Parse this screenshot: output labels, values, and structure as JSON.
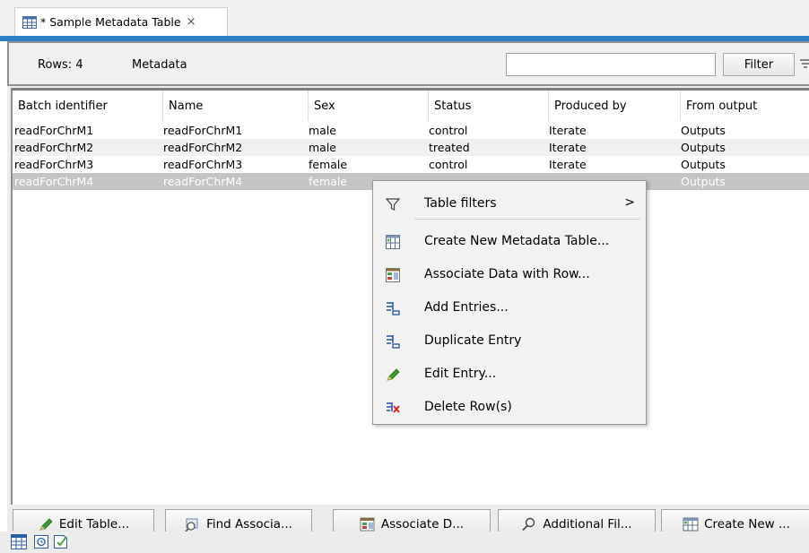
{
  "tab": {
    "title": "* Sample Metadata Table",
    "close_glyph": "×"
  },
  "toolbar": {
    "rows_label": "Rows: 4",
    "metadata_label": "Metadata",
    "filter_value": "",
    "filter_button": "Filter"
  },
  "table": {
    "columns": [
      "Batch identifier",
      "Name",
      "Sex",
      "Status",
      "Produced by",
      "From output"
    ],
    "rows": [
      [
        "readForChrM1",
        "readForChrM1",
        "male",
        "control",
        "Iterate",
        "Outputs"
      ],
      [
        "readForChrM2",
        "readForChrM2",
        "male",
        "treated",
        "Iterate",
        "Outputs"
      ],
      [
        "readForChrM3",
        "readForChrM3",
        "female",
        "control",
        "Iterate",
        "Outputs"
      ],
      [
        "readForChrM4",
        "readForChrM4",
        "female",
        "",
        "",
        "Outputs"
      ]
    ],
    "selected_row": 3
  },
  "context_menu": {
    "items": [
      {
        "label": "Table filters",
        "icon": "funnel-icon",
        "submenu_glyph": ">"
      },
      {
        "label": "Create New Metadata Table...",
        "icon": "new-table-icon"
      },
      {
        "label": "Associate Data with Row...",
        "icon": "associate-data-icon"
      },
      {
        "label": "Add Entries...",
        "icon": "add-entries-icon"
      },
      {
        "label": "Duplicate Entry",
        "icon": "duplicate-entry-icon"
      },
      {
        "label": "Edit Entry...",
        "icon": "pencil-icon"
      },
      {
        "label": "Delete Row(s)",
        "icon": "delete-rows-icon"
      }
    ]
  },
  "bottom_buttons": [
    {
      "label": "Edit Table...",
      "icon": "pencil-icon"
    },
    {
      "label": "Find Associa...",
      "icon": "find-icon"
    },
    {
      "label": "Associate D...",
      "icon": "associate-data-icon"
    },
    {
      "label": "Additional Fil...",
      "icon": "search-icon"
    },
    {
      "label": "Create New ...",
      "icon": "new-table-icon"
    }
  ],
  "status_icons": [
    "table-view-icon",
    "history-icon",
    "validate-icon"
  ],
  "colors": {
    "accent": "#2f7fc6",
    "selection": "#c4c4c4",
    "delete": "#e02020",
    "pencil": "#3a9a2a"
  }
}
